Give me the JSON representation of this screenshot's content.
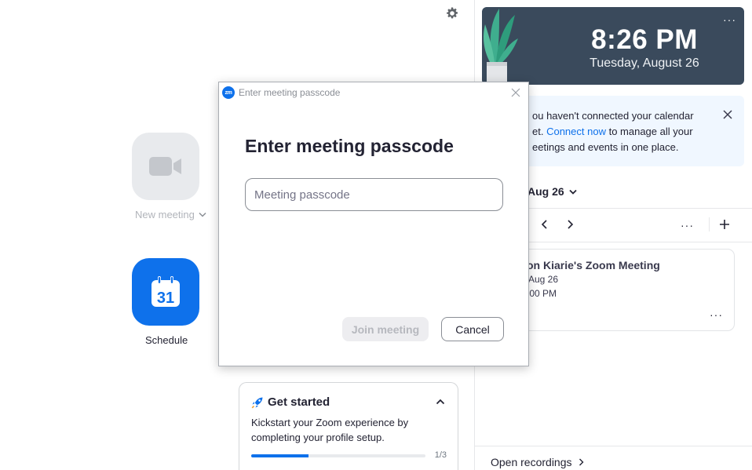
{
  "main": {
    "settings_icon": "gear-icon",
    "new_meeting": {
      "label": "New meeting",
      "icon": "video-camera-icon"
    },
    "schedule": {
      "label": "Schedule",
      "icon": "calendar-icon",
      "calendar_day": "31"
    }
  },
  "get_started": {
    "title": "Get started",
    "body": "Kickstart your Zoom experience by completing your profile setup.",
    "progress_fraction": 0.33,
    "progress_text": "1/3"
  },
  "right_panel": {
    "clock": {
      "time": "8:26 PM",
      "date": "Tuesday, August 26",
      "more": "···"
    },
    "calendar_banner": {
      "text_before": "ou haven't connected your calendar",
      "line2_before": "et. ",
      "link": "Connect now",
      "line2_after": " to manage all your",
      "line3": "eetings and events in one place."
    },
    "date_selector": "Aug 26",
    "list_more": "···",
    "meeting": {
      "title": "on Kiarie's Zoom Meeting",
      "date": "Aug 26",
      "time": ":00 PM",
      "more": "···"
    },
    "open_recordings": "Open recordings"
  },
  "dialog": {
    "logo": "zm",
    "title": "Enter meeting passcode",
    "heading": "Enter meeting passcode",
    "input_placeholder": "Meeting passcode",
    "input_value": "",
    "join_label": "Join meeting",
    "cancel_label": "Cancel"
  },
  "colors": {
    "accent": "#0e71eb",
    "clock_bg": "#3a4a5c",
    "banner_bg": "#f0f7ff",
    "tile_gray": "#e8eaed"
  }
}
